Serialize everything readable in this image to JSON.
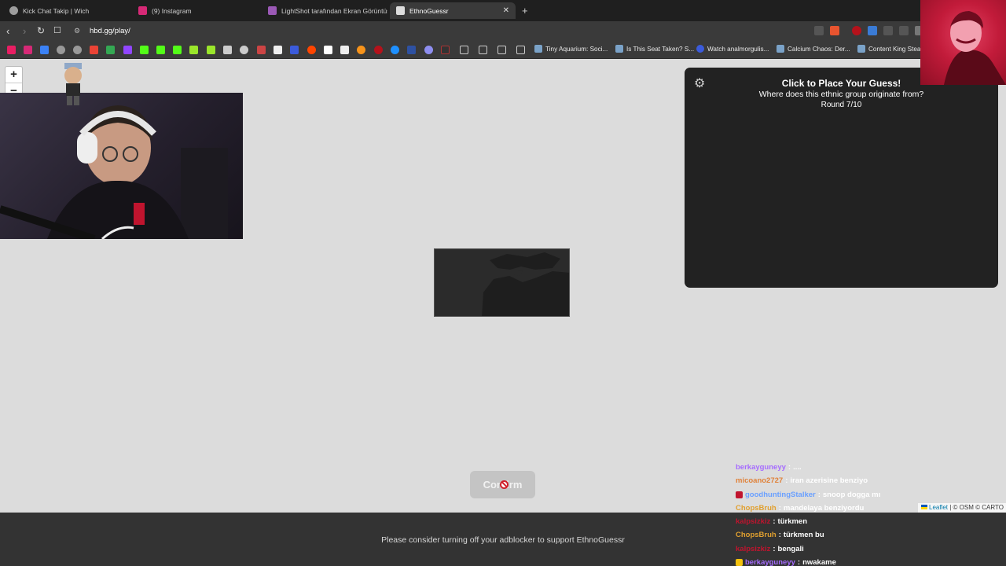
{
  "browser": {
    "tabs": [
      {
        "label": "Kick Chat Takip | Wich",
        "favicon_color": "#9e9e9e",
        "active": false
      },
      {
        "label": "(9) Instagram",
        "favicon_color": "#d62976",
        "active": false
      },
      {
        "label": "LightShot tarafından Ekran Görüntüsü",
        "favicon_color": "#9b59b6",
        "active": false
      },
      {
        "label": "EthnoGuessr",
        "favicon_color": "#dddddd",
        "active": true
      }
    ],
    "new_tab_glyph": "+",
    "close_glyph": "✕",
    "url": "hbd.gg/play/",
    "bookmarks": [
      {
        "label": "Tiny Aquarium: Soci..."
      },
      {
        "label": "Is This Seat Taken? S..."
      },
      {
        "label": "Watch analmorgulis..."
      },
      {
        "label": "Calcium Chaos: Der..."
      },
      {
        "label": "Content King Steam"
      }
    ]
  },
  "map": {
    "zoom_in": "+",
    "zoom_out": "−"
  },
  "panel": {
    "title": "Click to Place Your Guess!",
    "question": "Where does this ethnic group originate from?",
    "round": "Round 7/10"
  },
  "confirm": {
    "label": "Confirm"
  },
  "attribution": {
    "leaflet": "Leaflet",
    "rest": " | © OSM © CARTO"
  },
  "footer": {
    "text": "Please consider turning off your adblocker to support EthnoGuessr"
  },
  "chat": {
    "messages": [
      {
        "user": "berkayguneyy",
        "text": "....",
        "user_color": "#a66cff",
        "faded": true
      },
      {
        "user": "micoano2727",
        "text": "iran azerisine benziyo",
        "user_color": "#e0823a",
        "faded": true
      },
      {
        "user": "goodhuntingStalker",
        "text": "snoop dogga mı",
        "user_color": "#6aa0ff",
        "faded": true
      },
      {
        "user": "ChopsBruh",
        "text": "mandelaya benziyordu",
        "user_color": "#e0a030",
        "faded": true
      },
      {
        "user": "kalpsizkiz",
        "text": "türkmen",
        "user_color": "#c0142e",
        "faded": false
      },
      {
        "user": "ChopsBruh",
        "text": "türkmen bu",
        "user_color": "#e0a030",
        "faded": false
      },
      {
        "user": "kalpsizkiz",
        "text": "bengali",
        "user_color": "#c0142e",
        "faded": false
      },
      {
        "user": "berkayguneyy",
        "text": "nwakame",
        "user_color": "#a66cff",
        "faded": false
      }
    ]
  },
  "colors": {
    "panel_bg": "#222222",
    "page_bg": "#dcdcdc",
    "footer_bg": "#333333",
    "accent_red": "#c21b3a"
  }
}
